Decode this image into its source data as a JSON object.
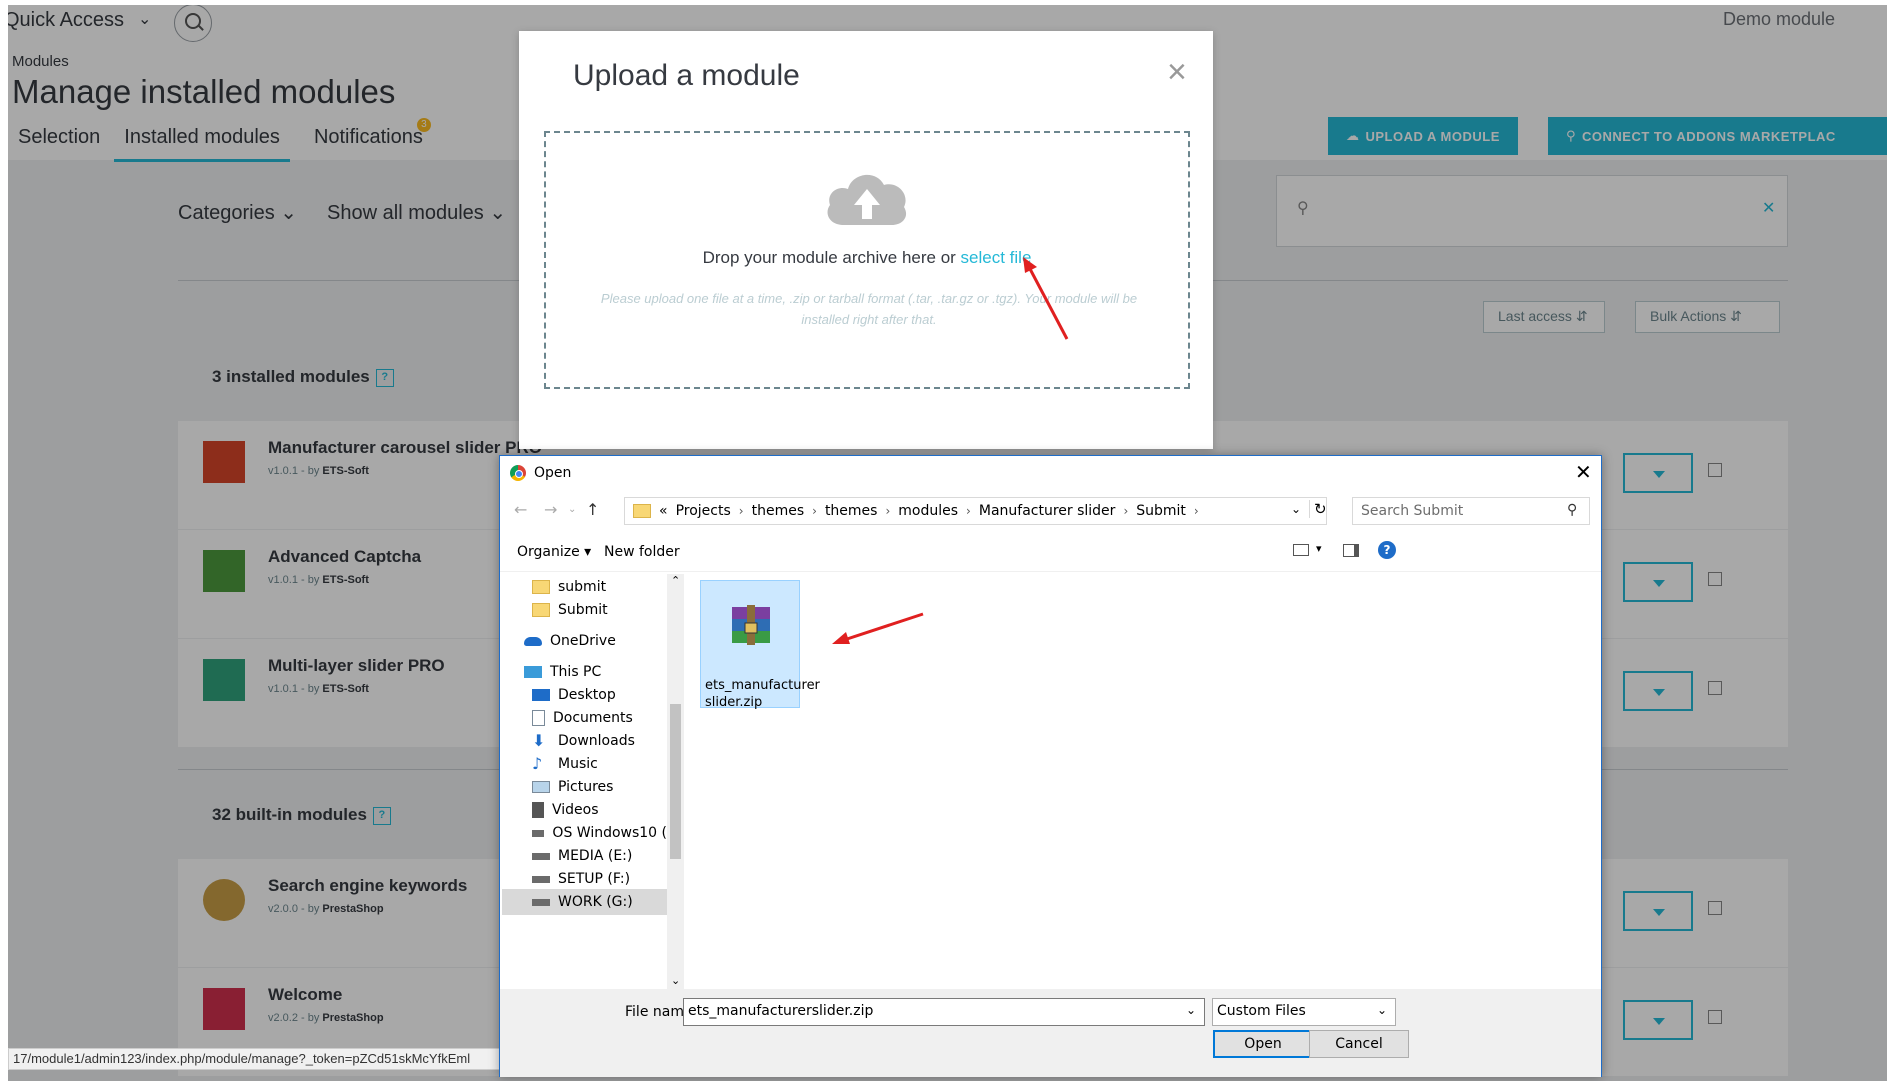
{
  "header": {
    "quick_access": "Quick Access",
    "shop_name": "Demo module",
    "breadcrumb": "Modules",
    "title": "Manage installed modules",
    "tabs": [
      {
        "label": "Selection"
      },
      {
        "label": "Installed modules",
        "active": true
      },
      {
        "label": "Notifications",
        "badge": "3"
      }
    ],
    "upload_button": "UPLOAD A MODULE",
    "connect_button": "CONNECT TO ADDONS MARKETPLAC"
  },
  "filters": {
    "categories": "Categories",
    "show_all": "Show all modules",
    "sort": "Last access",
    "bulk": "Bulk Actions"
  },
  "sections": [
    {
      "title": "3 installed modules"
    },
    {
      "title": "32 built-in modules"
    }
  ],
  "modules": [
    {
      "name": "Manufacturer carousel slider PRO",
      "version": "v1.0.1 - by",
      "author": "ETS-Soft",
      "icon_color": "#d7452a"
    },
    {
      "name": "Advanced Captcha",
      "version": "v1.0.1 - by",
      "author": "ETS-Soft",
      "icon_color": "#4d9a3e"
    },
    {
      "name": "Multi-layer slider PRO",
      "version": "v1.0.1 - by",
      "author": "ETS-Soft",
      "icon_color": "#2fa37d"
    },
    {
      "name": "Search engine keywords",
      "version": "v2.0.0 - by",
      "author": "PrestaShop",
      "icon_color": "#c89f46"
    },
    {
      "name": "Welcome",
      "version": "v2.0.2 - by",
      "author": "PrestaShop",
      "icon_color": "#d02f4e"
    }
  ],
  "status_url": "17/module1/admin123/index.php/module/manage?_token=pZCd51skMcYfkEml",
  "upload_modal": {
    "title": "Upload a module",
    "drop_text": "Drop your module archive here or",
    "select_link": "select file",
    "tip": "Please upload one file at a time, .zip or tarball format (.tar, .tar.gz or .tgz). Your module will be installed right after that."
  },
  "open_dialog": {
    "title": "Open",
    "path": [
      "Projects",
      "themes",
      "themes",
      "modules",
      "Manufacturer slider",
      "Submit"
    ],
    "path_prefix": "«",
    "search_placeholder": "Search Submit",
    "organize": "Organize",
    "new_folder": "New folder",
    "tree": [
      {
        "label": "submit",
        "icon": "folder-icon"
      },
      {
        "label": "Submit",
        "icon": "folder-icon"
      },
      {
        "label": "OneDrive",
        "icon": "onedrive-icon"
      },
      {
        "label": "This PC",
        "icon": "pc-icon"
      },
      {
        "label": "Desktop",
        "icon": "desktop-icon"
      },
      {
        "label": "Documents",
        "icon": "documents-icon"
      },
      {
        "label": "Downloads",
        "icon": "downloads-icon"
      },
      {
        "label": "Music",
        "icon": "music-icon"
      },
      {
        "label": "Pictures",
        "icon": "pictures-icon"
      },
      {
        "label": "Videos",
        "icon": "videos-icon"
      },
      {
        "label": "OS Windows10 (",
        "icon": "drive-icon"
      },
      {
        "label": "MEDIA (E:)",
        "icon": "drive-icon"
      },
      {
        "label": "SETUP (F:)",
        "icon": "drive-icon"
      },
      {
        "label": "WORK (G:)",
        "icon": "drive-icon",
        "selected": true
      }
    ],
    "file": {
      "name": "ets_manufacturer slider.zip",
      "icon": "winrar-archive-icon"
    },
    "file_name_label": "File name:",
    "file_name_value": "ets_manufacturerslider.zip",
    "file_type": "Custom Files",
    "open_button": "Open",
    "cancel_button": "Cancel"
  },
  "colors": {
    "accent": "#25b9d7",
    "annotation_arrow": "#e02020"
  }
}
